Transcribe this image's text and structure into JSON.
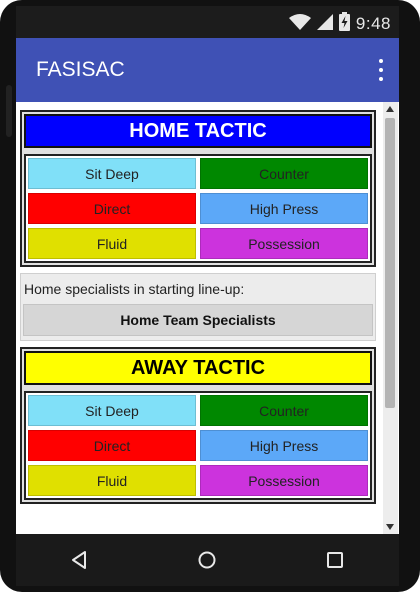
{
  "status_bar": {
    "time": "9:48",
    "icons": [
      "wifi-icon",
      "cellular-signal-icon",
      "battery-charging-icon"
    ]
  },
  "app_bar": {
    "title": "FASISAC",
    "menu_icon": "more-vert-icon"
  },
  "colors": {
    "app_bar": "#3f51b5",
    "home_title_bg": "#0000ff",
    "home_title_text": "#ffffff",
    "away_title_bg": "#ffff00",
    "away_title_text": "#000000",
    "sit_deep": "#80e0f8",
    "counter": "#008800",
    "direct": "#ff0000",
    "high_press": "#5ca8f8",
    "fluid": "#e0e000",
    "possession": "#cc33dd"
  },
  "home_tactic": {
    "title": "HOME TACTIC",
    "buttons": [
      {
        "label": "Sit Deep",
        "color": "#80e0f8"
      },
      {
        "label": "Counter",
        "color": "#008800"
      },
      {
        "label": "Direct",
        "color": "#ff0000"
      },
      {
        "label": "High Press",
        "color": "#5ca8f8"
      },
      {
        "label": "Fluid",
        "color": "#e0e000"
      },
      {
        "label": "Possession",
        "color": "#cc33dd"
      }
    ]
  },
  "home_specialists": {
    "label": "Home specialists in starting line-up:",
    "button_label": "Home Team Specialists"
  },
  "away_tactic": {
    "title": "AWAY TACTIC",
    "buttons": [
      {
        "label": "Sit Deep",
        "color": "#80e0f8"
      },
      {
        "label": "Counter",
        "color": "#008800"
      },
      {
        "label": "Direct",
        "color": "#ff0000"
      },
      {
        "label": "High Press",
        "color": "#5ca8f8"
      },
      {
        "label": "Fluid",
        "color": "#e0e000"
      },
      {
        "label": "Possession",
        "color": "#cc33dd"
      }
    ]
  },
  "nav_bar": {
    "buttons": [
      "back-icon",
      "home-icon",
      "recents-icon"
    ]
  }
}
